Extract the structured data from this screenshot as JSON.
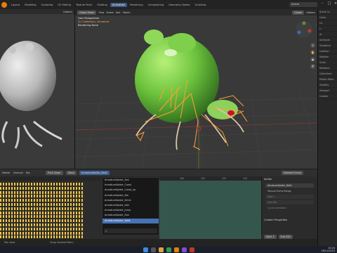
{
  "topbar": {
    "tabs": [
      "Layout",
      "Modeling",
      "Sculpting",
      "UV Editing",
      "Texture Paint",
      "Shading",
      "Animation",
      "Rendering",
      "Compositing",
      "Geometry Nodes",
      "Scripting"
    ],
    "active_tab": "Animation",
    "scene": "Scene"
  },
  "viewport": {
    "mode": "Object Mode",
    "menus": [
      "View",
      "Select",
      "Add",
      "Object"
    ],
    "transform": "Global",
    "overlay_lines": [
      "User Perspective",
      "(1) Collection | Armature",
      "Rendering Done"
    ],
    "options_label": "Options"
  },
  "left_view": {
    "options_label": "Options"
  },
  "timeline": {
    "menus": [
      "Marker",
      "Channel",
      "Key"
    ],
    "push_down": "Push Down",
    "stash": "Stash",
    "action_field": "ArmatureSpider_Walk",
    "frame_ticks": [
      "180",
      "200",
      "220",
      "240"
    ],
    "interpolation": "Nearest Frame"
  },
  "dropdown": {
    "items": [
      "ArmatureSpider_Ack",
      "ArmatureSpider_Crawl",
      "ArmatureSpider_Crawl_up",
      "ArmatureSpider_Die",
      "ArmatureSpider_Drink",
      "ArmatureSpider_Idle",
      "ArmatureSpider_Jump",
      "ArmatureSpider_Run",
      "ArmatureSpider_Walk"
    ],
    "selected": "ArmatureSpider_Walk",
    "search_icon": "search-icon"
  },
  "action_panel": {
    "title": "Action",
    "action_name": "ArmatureSpider_Walk",
    "manual_frame_range": "Manual Frame Range",
    "start": "Start",
    "end": "End",
    "cyclic": "Cyclic Animation",
    "custom_properties": "Custom Properties",
    "start_val": "1",
    "end_val": "250"
  },
  "playback": {
    "start_label": "Start",
    "start_val": "1",
    "end_label": "End",
    "end_val": "250"
  },
  "status": [
    "Pan View",
    "Snap Context Menu"
  ],
  "right_panel": {
    "rows": [
      "Scene Co",
      "Collec",
      "Ca",
      "Li",
      "Ar",
      "Armature",
      "Transform",
      "Location",
      "Rotation",
      "Scale",
      "Relations",
      "Collections",
      "Motion Paths",
      "Visibility",
      "Viewport",
      "Custom"
    ]
  },
  "taskbar": {
    "time": "10:24",
    "date": "16/11/2023"
  },
  "colors": {
    "accent": "#4772b3",
    "keyframe": "#f2c744",
    "bone": "#ffa034",
    "spider_green": "#6ec43e"
  }
}
